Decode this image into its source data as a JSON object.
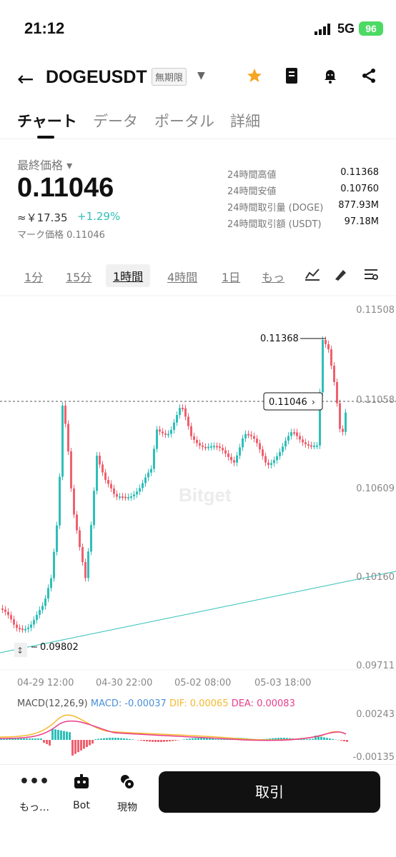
{
  "status": {
    "time": "21:12",
    "network": "5G",
    "battery": "96"
  },
  "header": {
    "pair": "DOGEUSDT",
    "badge": "無期限"
  },
  "tabs": [
    "チャート",
    "データ",
    "ポータル",
    "詳細"
  ],
  "price": {
    "label": "最終価格",
    "last": "0.11046",
    "fiat": "≈￥17.35",
    "change": "+1.29%",
    "mark": "マーク価格 0.11046"
  },
  "stats": [
    {
      "label": "24時間高値",
      "value": "0.11368"
    },
    {
      "label": "24時間安値",
      "value": "0.10760"
    },
    {
      "label": "24時間取引量 (DOGE)",
      "value": "877.93M"
    },
    {
      "label": "24時間取引額 (USDT)",
      "value": "97.18M"
    }
  ],
  "timeframes": [
    "1分",
    "15分",
    "1時間",
    "4時間",
    "1日",
    "もっ"
  ],
  "chart": {
    "y_ticks": [
      "0.11508",
      "0.11058",
      "0.10609",
      "0.10160",
      "0.09711"
    ],
    "x_ticks": [
      "04-29 12:00",
      "04-30 22:00",
      "05-02 08:00",
      "05-03 18:00"
    ],
    "high_label": "0.11368",
    "low_label": "0.09802",
    "current_label": "0.11046",
    "watermark": "Bitget"
  },
  "macd": {
    "title": "MACD(12,26,9)",
    "macd": "MACD: -0.00037",
    "dif": "DIF: 0.00065",
    "dea": "DEA: 0.00083",
    "y_top": "0.00243",
    "y_bottom": "-0.00135"
  },
  "nav": {
    "more": "もっ…",
    "bot": "Bot",
    "spot": "現物",
    "trade": "取引"
  },
  "colors": {
    "up": "#2ebfb8",
    "down": "#f0606e",
    "accent": "#f5a623",
    "dif": "#f5b82e",
    "dea": "#e83e8c",
    "macd": "#4a90d9"
  },
  "chart_data": {
    "type": "candlestick",
    "x": [
      "04-29 12:00",
      "04-30 22:00",
      "05-02 08:00",
      "05-03 18:00"
    ],
    "ylim": [
      0.09711,
      0.11508
    ],
    "high": 0.11368,
    "low": 0.09802,
    "last": 0.11046,
    "macd": {
      "macd": -0.00037,
      "dif": 0.00065,
      "dea": 0.00083,
      "ylim": [
        -0.00135,
        0.00243
      ]
    }
  }
}
